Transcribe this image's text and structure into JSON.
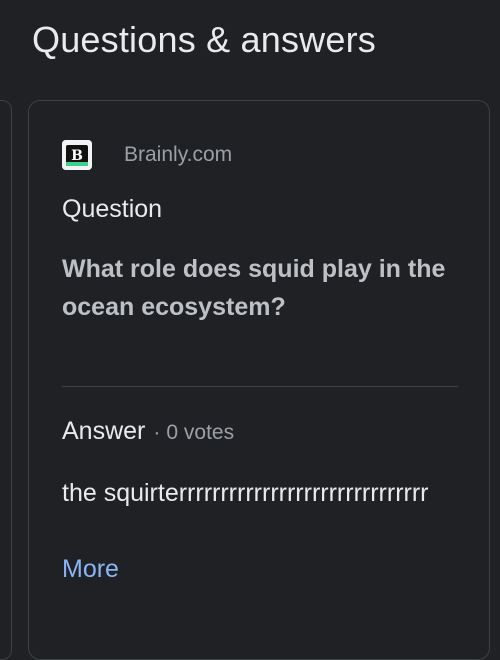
{
  "section": {
    "title": "Questions & answers"
  },
  "card": {
    "source": {
      "name": "Brainly.com",
      "logo_icon": "brainly-logo-icon",
      "logo_letter": "B"
    },
    "question_label": "Question",
    "question_text": "What role does squid play in the ocean ecosystem?",
    "answer_label": "Answer",
    "separator": "·",
    "votes": "0 votes",
    "answer_text": "the squirterrrrrrrrrrrrrrrrrrrrrrrrrrrrrr",
    "more_label": "More"
  },
  "colors": {
    "background": "#202124",
    "card_border": "#3c4043",
    "text_primary": "#e8eaed",
    "text_secondary": "#9aa0a6",
    "link": "#8ab4f8"
  }
}
